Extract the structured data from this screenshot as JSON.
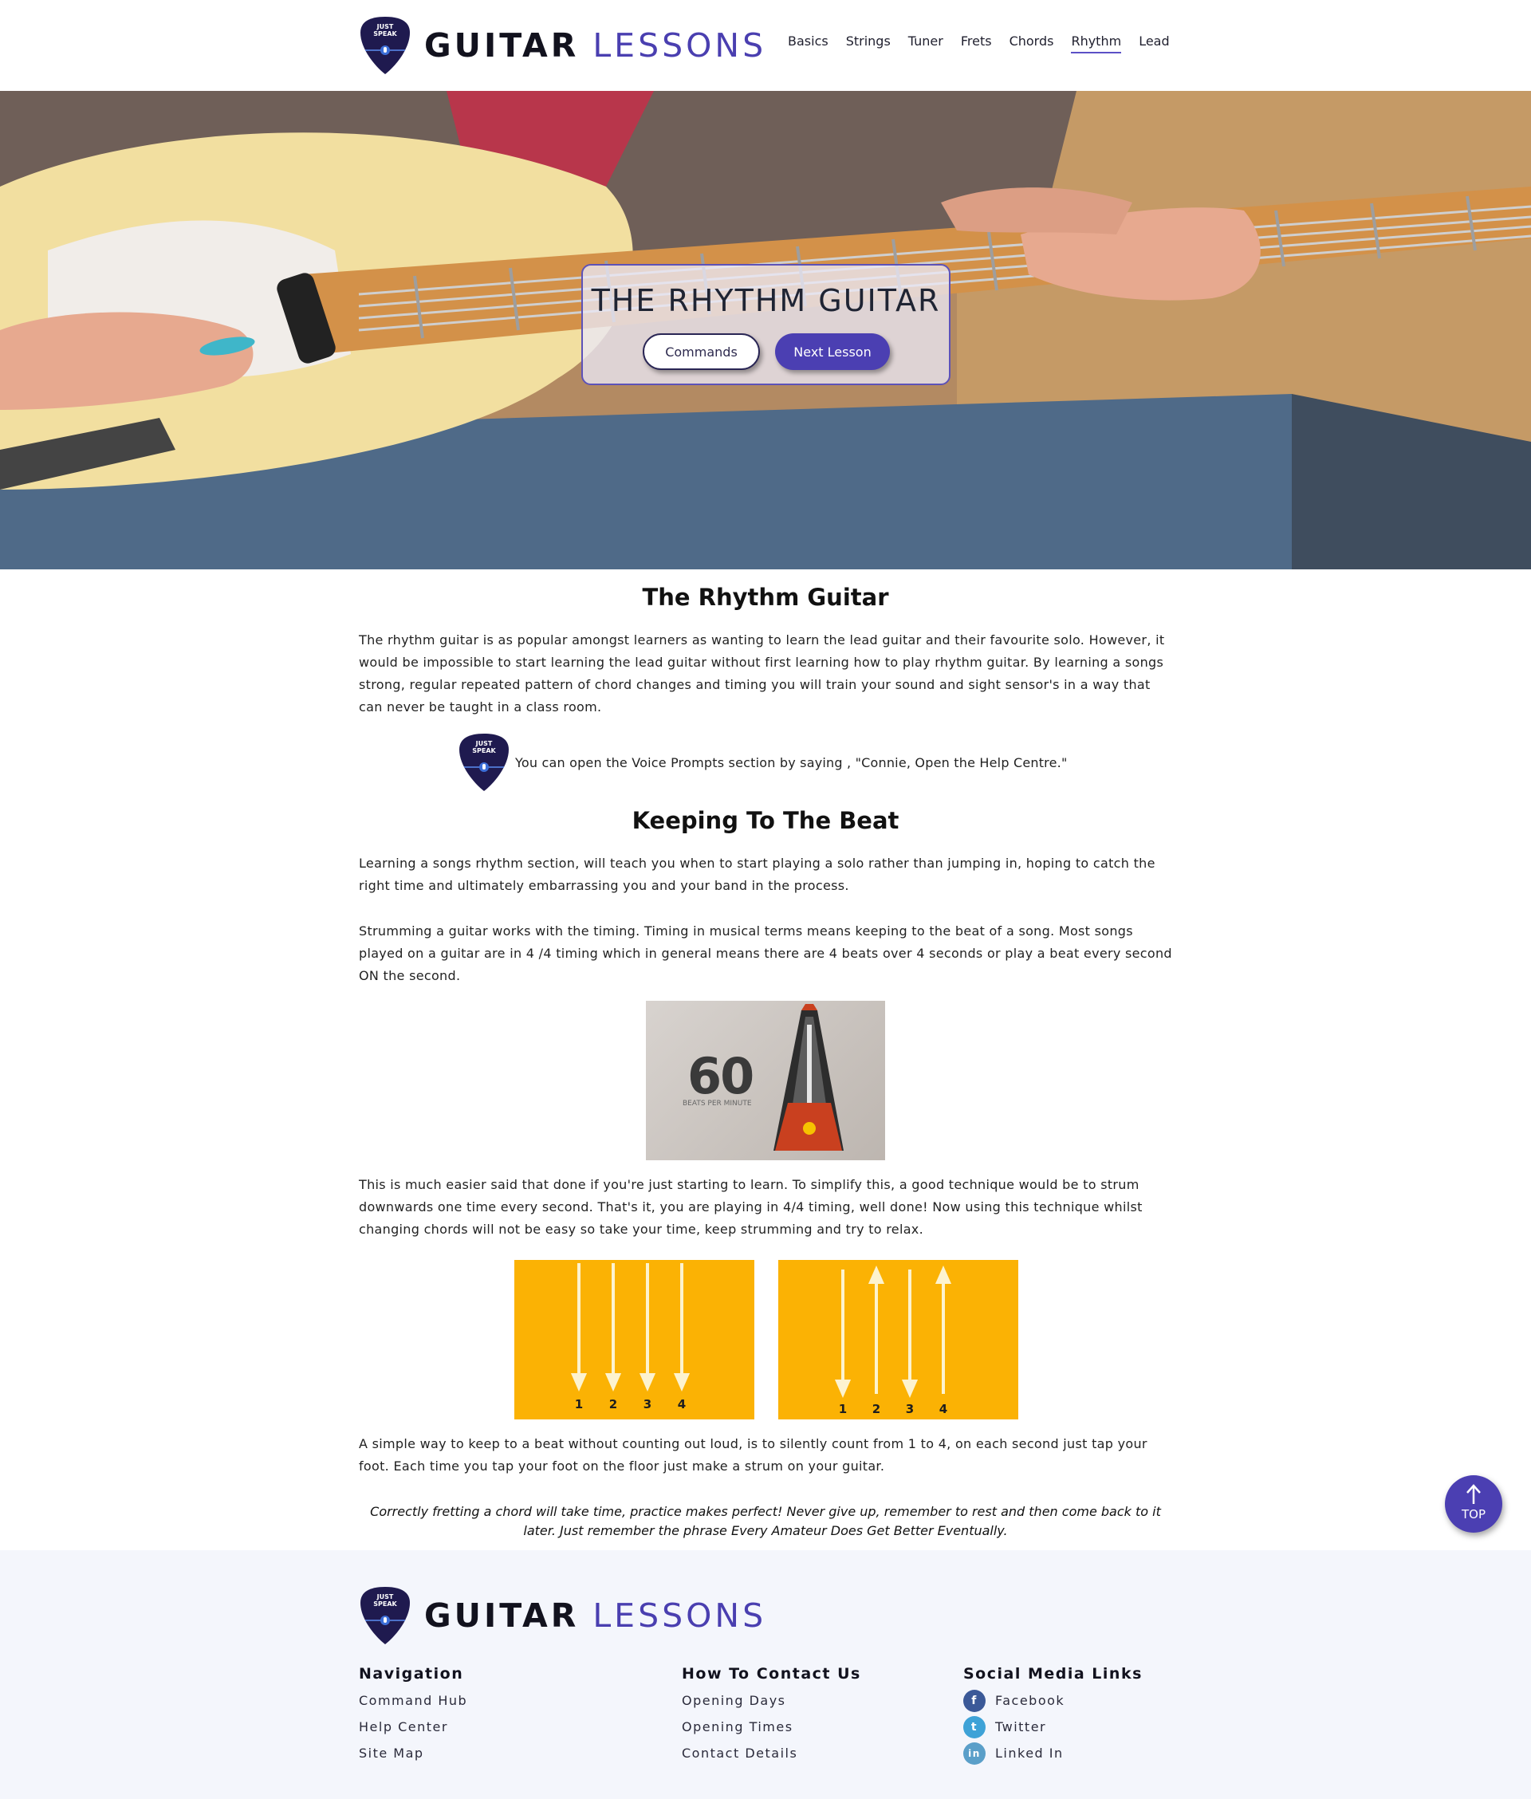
{
  "brand": {
    "pick_text_top": "JUST",
    "pick_text_bottom": "SPEAK",
    "word1": "GUITAR",
    "word2": "LESSONS",
    "pick_color": "#1f1a4f",
    "accent_color": "#4a3fb0"
  },
  "nav": {
    "items": [
      {
        "label": "Basics",
        "active": false
      },
      {
        "label": "Strings",
        "active": false
      },
      {
        "label": "Tuner",
        "active": false
      },
      {
        "label": "Frets",
        "active": false
      },
      {
        "label": "Chords",
        "active": false
      },
      {
        "label": "Rhythm",
        "active": true
      },
      {
        "label": "Lead",
        "active": false
      }
    ]
  },
  "hero": {
    "title": "THE RHYTHM GUITAR",
    "commands_label": "Commands",
    "next_label": "Next Lesson"
  },
  "content": {
    "heading1": "The Rhythm Guitar",
    "para1": "The rhythm guitar is as popular amongst learners as wanting to learn the lead guitar and their favourite solo. However, it would be impossible to start learning the lead guitar without first learning how to play rhythm guitar. By learning a songs strong, regular repeated pattern of chord changes and timing you will train your sound and sight sensor's in a way that can never be taught in a class room.",
    "voice_prompt": "You can open the Voice Prompts section by saying , \"Connie, Open the Help Centre.\"",
    "heading2": "Keeping To The Beat",
    "para2": "Learning a songs rhythm section, will teach you when to start playing a solo rather than jumping in, hoping to catch the right time and ultimately embarrassing you and your band in the process.",
    "para3": "Strumming a guitar works with the timing. Timing in musical terms means keeping to the beat of a song. Most songs played on a guitar are in 4 /4 timing which in general means there are 4 beats over 4 seconds or play a beat every second ON the second.",
    "metronome": {
      "bpm": "60",
      "caption": "BEATS PER MINUTE"
    },
    "para4": "This is much easier said that done if you're just starting to learn. To simplify this, a good technique would be to strum downwards one time every second. That's it, you are playing in 4/4 timing, well done! Now using this technique whilst changing chords will not be easy so take your time, keep strumming and try to relax.",
    "strum_left": {
      "numbers": [
        "1",
        "2",
        "3",
        "4"
      ],
      "directions": [
        "down",
        "down",
        "down",
        "down"
      ]
    },
    "strum_right": {
      "numbers": [
        "1",
        "2",
        "3",
        "4"
      ],
      "directions": [
        "down",
        "up",
        "down",
        "up"
      ]
    },
    "para5": "A simple way to keep to a beat without counting out loud, is to silently count from 1 to 4, on each second just tap your foot. Each time you tap your foot on the floor just make a strum on your guitar.",
    "quote": "Correctly fretting a chord will take time, practice makes perfect! Never give up, remember to rest and then come back to it later. Just remember the phrase Every Amateur Does Get Better Eventually."
  },
  "top_button": {
    "label": "TOP"
  },
  "footer": {
    "navigation": {
      "heading": "Navigation",
      "links": [
        "Command Hub",
        "Help Center",
        "Site Map"
      ]
    },
    "contact": {
      "heading": "How To Contact Us",
      "links": [
        "Opening Days",
        "Opening Times",
        "Contact Details"
      ]
    },
    "social": {
      "heading": "Social Media Links",
      "links": [
        {
          "label": "Facebook",
          "icon": "facebook-icon",
          "glyph": "f",
          "color": "#3b5998"
        },
        {
          "label": "Twitter",
          "icon": "twitter-icon",
          "glyph": "t",
          "color": "#3ea2d7"
        },
        {
          "label": "Linked In",
          "icon": "linkedin-icon",
          "glyph": "in",
          "color": "#5a9fc9"
        }
      ]
    }
  }
}
